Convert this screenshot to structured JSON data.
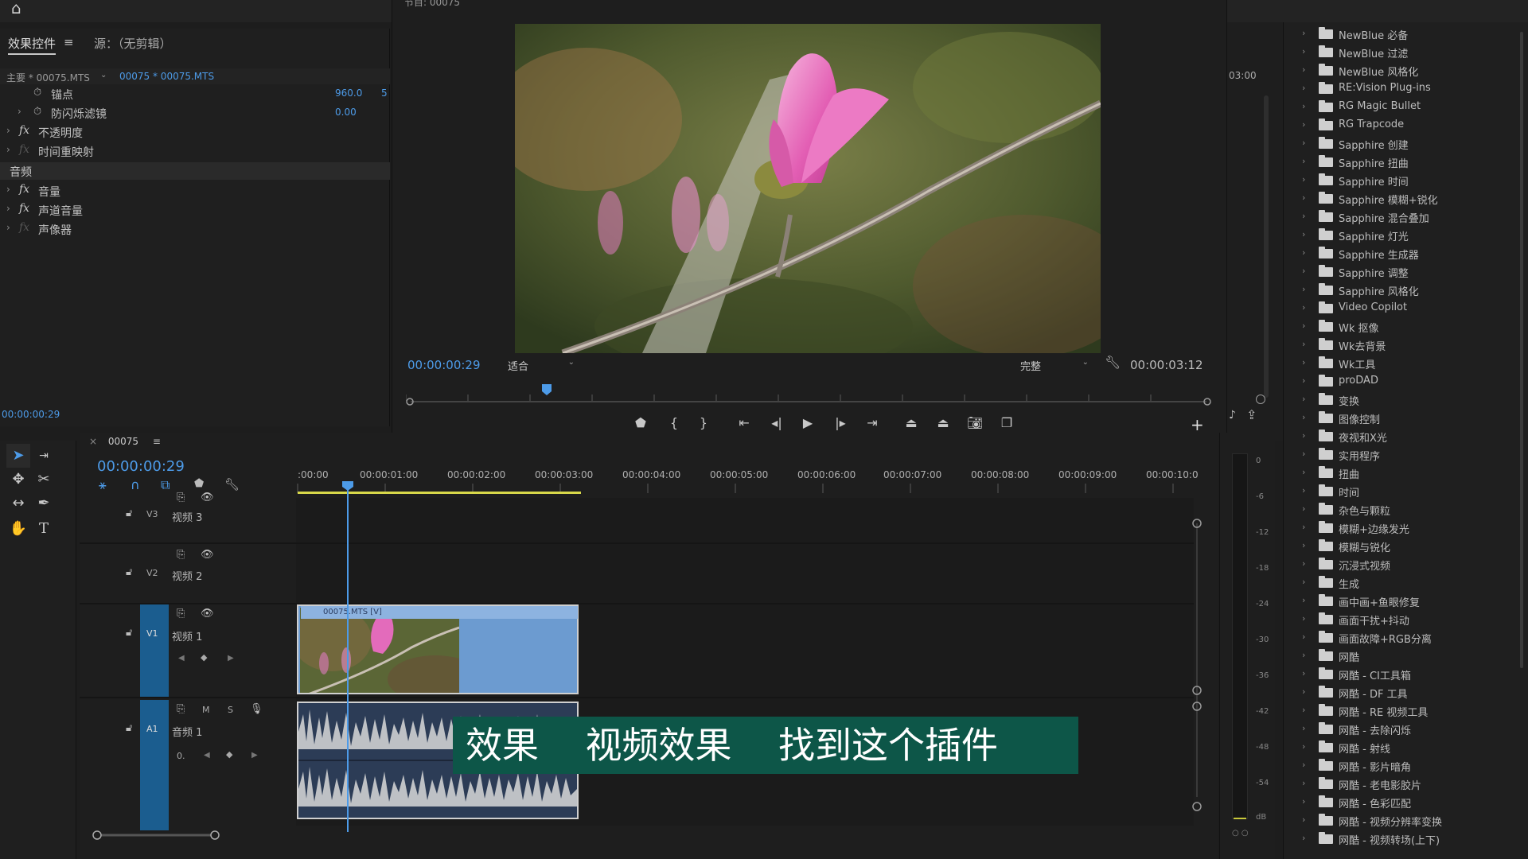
{
  "header": {
    "home_icon": "home-icon"
  },
  "effect_controls": {
    "tab_label": "效果控件",
    "source_tab_label": "源：（无剪辑）",
    "master_label": "主要 * 00075.MTS",
    "clip_label": "00075 * 00075.MTS",
    "rows": [
      {
        "label": "锚点",
        "value": "960.0",
        "value2": "5"
      },
      {
        "label": "防闪烁滤镜",
        "value": "0.00"
      },
      {
        "label": "不透明度"
      },
      {
        "label": "时间重映射"
      }
    ],
    "audio_section": "音频",
    "audio_rows": [
      {
        "label": "音量"
      },
      {
        "label": "声道音量"
      },
      {
        "label": "声像器"
      }
    ],
    "timecode": "00:00:00:29"
  },
  "program_monitor": {
    "title": "节目: 00075",
    "timecode": "00:00:00:29",
    "fit_option": "适合",
    "quality_option": "完整",
    "duration": "00:00:03:12"
  },
  "right_strip": {
    "timecode": "03:00"
  },
  "timeline": {
    "sequence_name": "00075",
    "timecode": "00:00:00:29",
    "ruler_labels": [
      ":00:00",
      "00:00:01:00",
      "00:00:02:00",
      "00:00:03:00",
      "00:00:04:00",
      "00:00:05:00",
      "00:00:06:00",
      "00:00:07:00",
      "00:00:08:00",
      "00:00:09:00",
      "00:00:10:0"
    ],
    "tracks": {
      "v3": {
        "id": "V3",
        "name": "视频 3"
      },
      "v2": {
        "id": "V2",
        "name": "视频 2"
      },
      "v1": {
        "id": "V1",
        "name": "视频 1"
      },
      "a1": {
        "id": "A1",
        "name": "音频 1",
        "m": "M",
        "s": "S",
        "vol": "0."
      }
    },
    "video_clip_label": "00075.MTS [V]"
  },
  "subtitle": "效果    视频效果    找到这个插件",
  "meter": {
    "labels": [
      "0",
      "-6",
      "-12",
      "-18",
      "-24",
      "-30",
      "-36",
      "-42",
      "-48",
      "-54",
      "dB"
    ]
  },
  "effects_list": [
    "NewBlue 必备",
    "NewBlue 过滤",
    "NewBlue 风格化",
    "RE:Vision Plug-ins",
    "RG Magic Bullet",
    "RG Trapcode",
    "Sapphire 创建",
    "Sapphire 扭曲",
    "Sapphire 时间",
    "Sapphire 模糊+锐化",
    "Sapphire 混合叠加",
    "Sapphire 灯光",
    "Sapphire 生成器",
    "Sapphire 调整",
    "Sapphire 风格化",
    "Video Copilot",
    "Wk 抠像",
    "Wk去背景",
    "Wk工具",
    "proDAD",
    "变换",
    "图像控制",
    "夜视和X光",
    "实用程序",
    "扭曲",
    "时间",
    "杂色与颗粒",
    "模糊+边缘发光",
    "模糊与锐化",
    "沉浸式视频",
    "生成",
    "画中画+鱼眼修复",
    "画面干扰+抖动",
    "画面故障+RGB分离",
    "网酷",
    "网酷 - CI工具箱",
    "网酷 - DF 工具",
    "网酷 - RE 视频工具",
    "网酷 - 去除闪烁",
    "网酷 - 射线",
    "网酷 - 影片暗角",
    "网酷 - 老电影胶片",
    "网酷 - 色彩匹配",
    "网酷 - 视频分辨率变换",
    "网酷 - 视频转场(上下)"
  ]
}
